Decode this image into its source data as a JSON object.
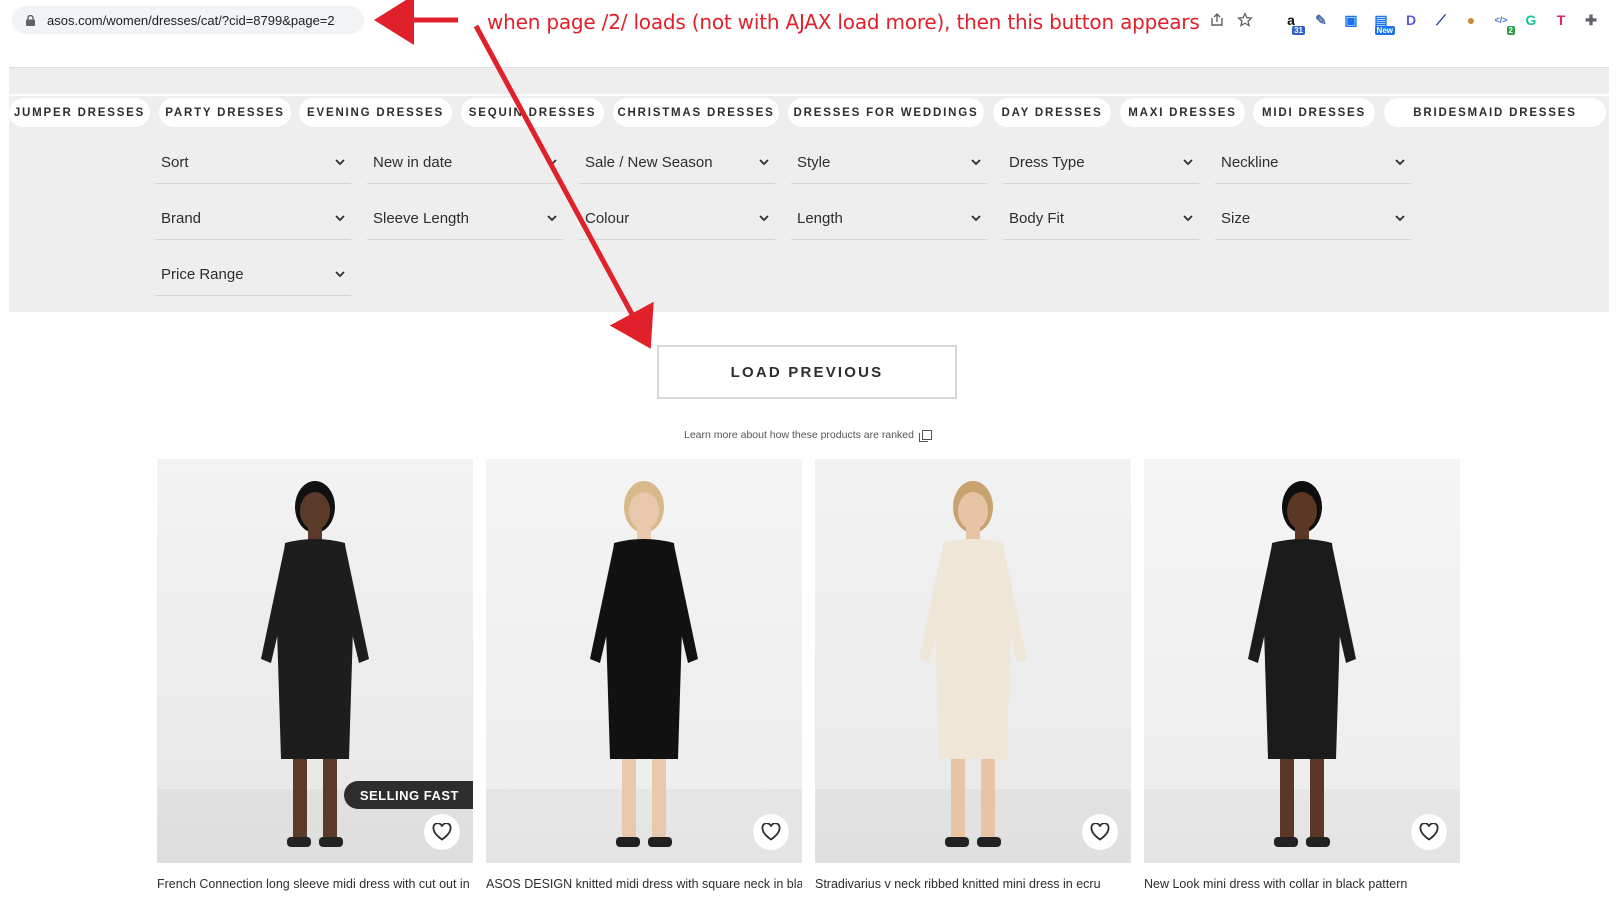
{
  "browser": {
    "url": "asos.com/women/dresses/cat/?cid=8799&page=2",
    "extensions": [
      {
        "icon": "amazon-icon",
        "glyph": "a",
        "color": "#111",
        "badge": "31",
        "badge_color": "#2f5fc4"
      },
      {
        "icon": "eyedropper-icon",
        "glyph": "✎",
        "color": "#4a6fa5",
        "badge": "",
        "badge_color": ""
      },
      {
        "icon": "tab-icon",
        "glyph": "▣",
        "color": "#1a73e8",
        "badge": "",
        "badge_color": ""
      },
      {
        "icon": "new-icon",
        "glyph": "▤",
        "color": "#1a73e8",
        "badge": "New",
        "badge_color": "#1a73e8"
      },
      {
        "icon": "d-icon",
        "glyph": "D",
        "color": "#5b5bd6",
        "badge": "",
        "badge_color": ""
      },
      {
        "icon": "pen-icon",
        "glyph": "⟋",
        "color": "#1a3c8a",
        "badge": "",
        "badge_color": ""
      },
      {
        "icon": "cookie-icon",
        "glyph": "●",
        "color": "#c98a3b",
        "badge": "",
        "badge_color": ""
      },
      {
        "icon": "code-icon",
        "glyph": "</>",
        "color": "#3b6bd6",
        "badge": "2",
        "badge_color": "#2e9c4a"
      },
      {
        "icon": "grammarly-icon",
        "glyph": "G",
        "color": "#15c39a",
        "badge": "",
        "badge_color": ""
      },
      {
        "icon": "t-icon",
        "glyph": "T",
        "color": "#e0245e",
        "badge": "",
        "badge_color": ""
      },
      {
        "icon": "puzzle-icon",
        "glyph": "✚",
        "color": "#5f6368",
        "badge": "",
        "badge_color": ""
      }
    ]
  },
  "annotation": {
    "note": "when page /2/ loads (not with AJAX load more), then this button appears",
    "color": "#e0202a"
  },
  "categories": [
    "JUMPER DRESSES",
    "PARTY DRESSES",
    "EVENING DRESSES",
    "SEQUIN DRESSES",
    "CHRISTMAS DRESSES",
    "DRESSES FOR WEDDINGS",
    "DAY DRESSES",
    "MAXI DRESSES",
    "MIDI DRESSES",
    "BRIDESMAID DRESSES"
  ],
  "filters": [
    "Sort",
    "New in date",
    "Sale / New Season",
    "Style",
    "Dress Type",
    "Neckline",
    "Brand",
    "Sleeve Length",
    "Colour",
    "Length",
    "Body Fit",
    "Size",
    "Price Range"
  ],
  "load_previous": "LOAD PREVIOUS",
  "ranking_link": "Learn more about how these products are ranked",
  "products": [
    {
      "title": "French Connection long sleeve midi dress with cut out in faux leather",
      "badge": "SELLING FAST"
    },
    {
      "title": "ASOS DESIGN knitted midi dress with square neck in black",
      "badge": ""
    },
    {
      "title": "Stradivarius v neck ribbed knitted mini dress in ecru",
      "badge": ""
    },
    {
      "title": "New Look mini dress with collar in black pattern",
      "badge": ""
    }
  ]
}
